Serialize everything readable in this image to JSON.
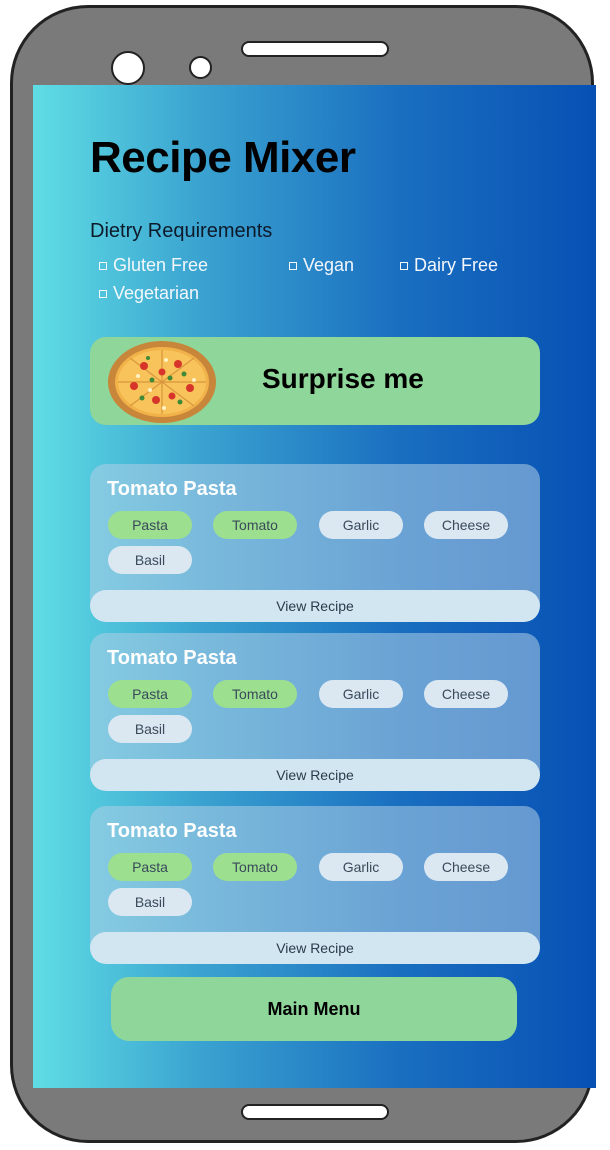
{
  "app": {
    "title": "Recipe Mixer"
  },
  "diet": {
    "heading": "Dietry Requirements",
    "options": [
      "Gluten Free",
      "Vegan",
      "Dairy Free",
      "Vegetarian"
    ]
  },
  "surprise": {
    "label": "Surprise me"
  },
  "recipes": [
    {
      "title": "Tomato Pasta",
      "ingredients": [
        "Pasta",
        "Tomato",
        "Garlic",
        "Cheese",
        "Basil"
      ],
      "view_label": "View Recipe"
    },
    {
      "title": "Tomato Pasta",
      "ingredients": [
        "Pasta",
        "Tomato",
        "Garlic",
        "Cheese",
        "Basil"
      ],
      "view_label": "View Recipe"
    },
    {
      "title": "Tomato Pasta",
      "ingredients": [
        "Pasta",
        "Tomato",
        "Garlic",
        "Cheese",
        "Basil"
      ],
      "view_label": "View Recipe"
    }
  ],
  "footer": {
    "main_menu_label": "Main Menu"
  },
  "colors": {
    "accent_green": "#8ed69a",
    "chip_green": "#9bdf8f",
    "chip_light": "#dbe8f2",
    "gradient_start": "#5fdde4",
    "gradient_end": "#0750b4"
  },
  "icons": {
    "surprise_image": "pizza-icon"
  }
}
